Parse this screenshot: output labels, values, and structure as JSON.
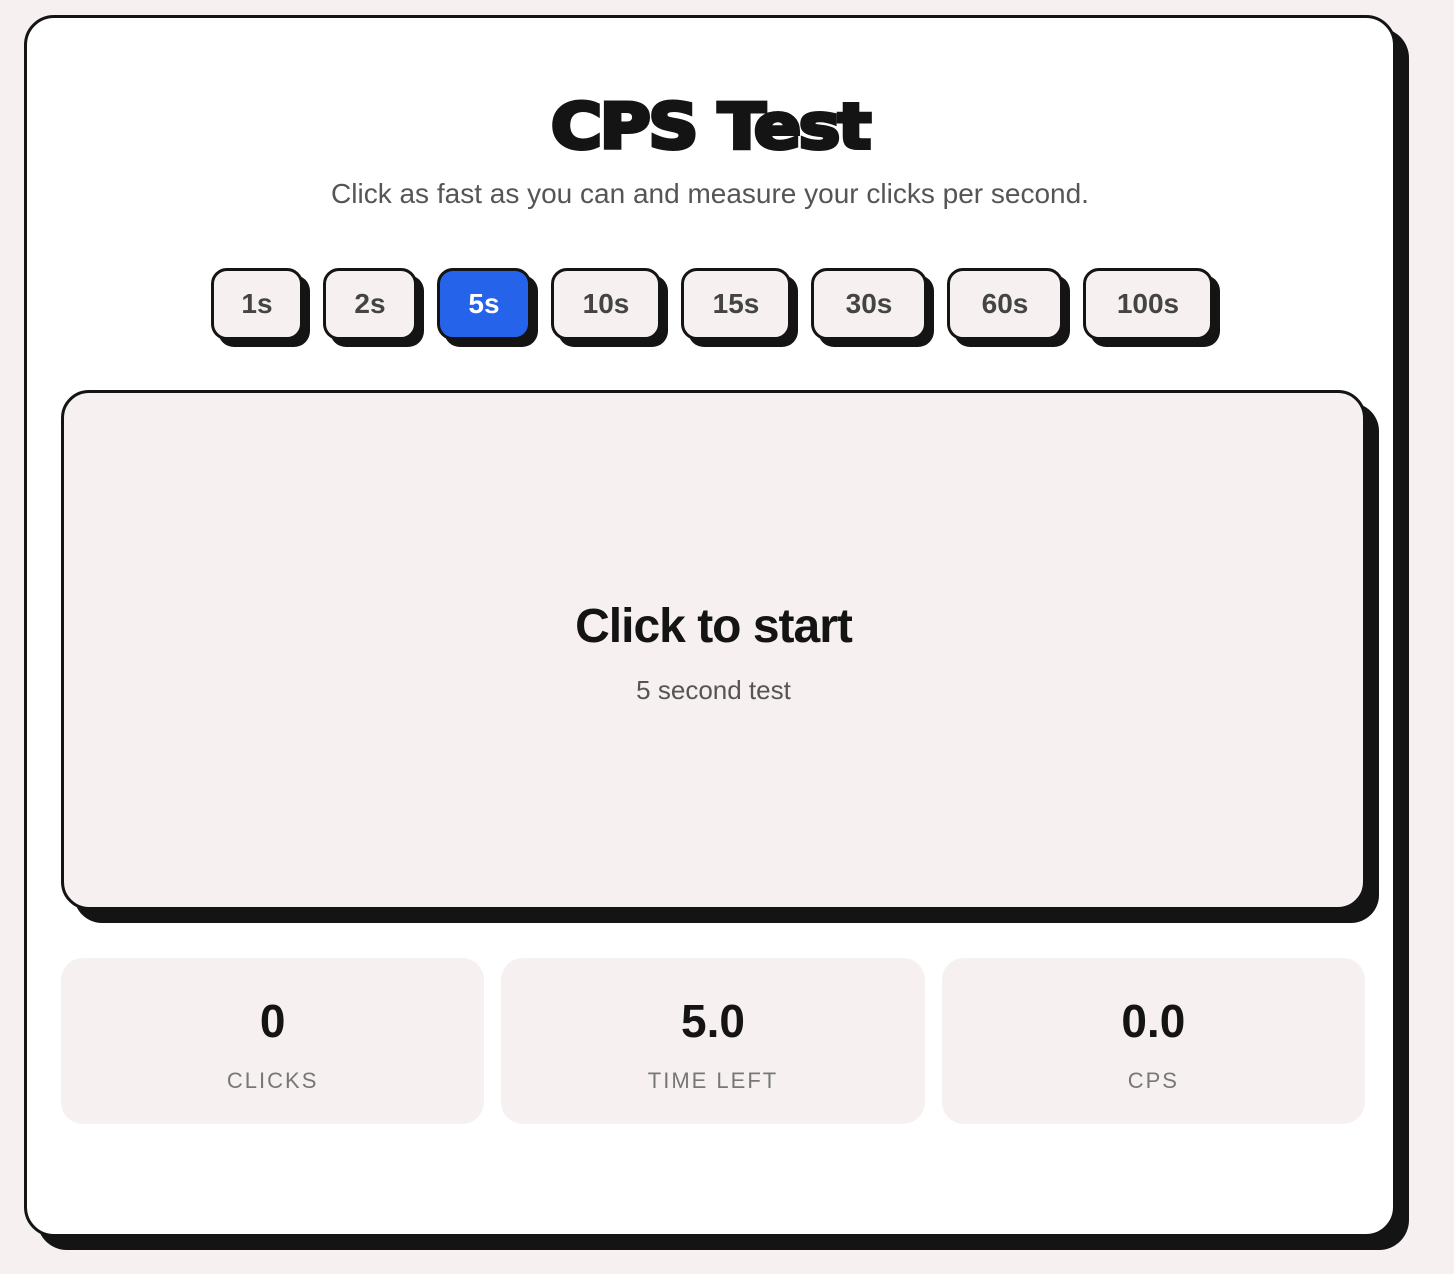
{
  "header": {
    "title": "CPS Test",
    "subtitle": "Click as fast as you can and measure your clicks per second."
  },
  "durations": {
    "options": [
      "1s",
      "2s",
      "5s",
      "10s",
      "15s",
      "30s",
      "60s",
      "100s"
    ],
    "selected": "5s"
  },
  "click_area": {
    "title": "Click to start",
    "subtitle": "5 second test"
  },
  "stats": {
    "clicks": {
      "value": "0",
      "label": "CLICKS"
    },
    "time_left": {
      "value": "5.0",
      "label": "TIME LEFT"
    },
    "cps": {
      "value": "0.0",
      "label": "CPS"
    }
  },
  "colors": {
    "accent": "#2563eb",
    "ink": "#141414",
    "background": "#f6f1f0"
  }
}
